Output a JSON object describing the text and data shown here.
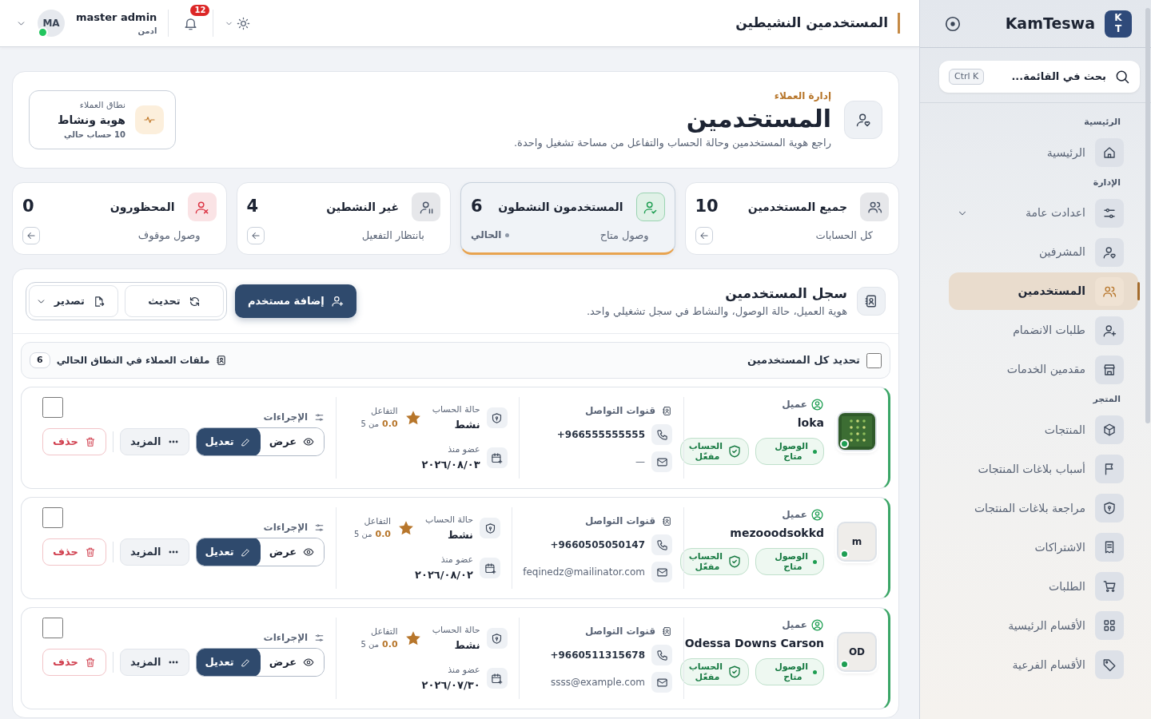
{
  "sidebar": {
    "brand": "KamTeswa",
    "logo": "K T",
    "search": {
      "placeholder": "بحث في القائمة...",
      "shortcut": "Ctrl K"
    },
    "sections": [
      {
        "title": "الرئيسية",
        "items": [
          {
            "label": "الرئيسية",
            "kind": "link",
            "selected": false
          }
        ]
      },
      {
        "title": "الإدارة",
        "items": [
          {
            "label": "اعدادت عامة",
            "kind": "group",
            "selected": false
          },
          {
            "label": "المشرفين",
            "kind": "link",
            "selected": false
          },
          {
            "label": "المستخدمين",
            "kind": "link",
            "selected": true
          },
          {
            "label": "طلبات الانضمام",
            "kind": "link",
            "selected": false
          },
          {
            "label": "مقدمين الخدمات",
            "kind": "link",
            "selected": false
          }
        ]
      },
      {
        "title": "المتجر",
        "items": [
          {
            "label": "المنتجات",
            "kind": "link",
            "selected": false
          },
          {
            "label": "أسباب بلاغات المنتجات",
            "kind": "link",
            "selected": false
          },
          {
            "label": "مراجعة بلاغات المنتجات",
            "kind": "link",
            "selected": false
          },
          {
            "label": "الاشتراكات",
            "kind": "link",
            "selected": false
          },
          {
            "label": "الطلبات",
            "kind": "link",
            "selected": false
          },
          {
            "label": "الأقسام الرئيسية",
            "kind": "link",
            "selected": false
          },
          {
            "label": "الأقسام الفرعية",
            "kind": "link",
            "selected": false
          }
        ]
      }
    ]
  },
  "topbar": {
    "title": "المستخدمين النشيطين",
    "notifications": "12",
    "user": {
      "name": "master admin",
      "role": "ادمن",
      "initials": "MA",
      "online": true
    }
  },
  "header": {
    "eyebrow": "إدارة العملاء",
    "title": "المستخدمين",
    "subtitle": "راجع هوية المستخدمين وحالة الحساب والتفاعل من مساحة تشغيل واحدة.",
    "scope": {
      "label": "نطاق العملاء",
      "value": "هوية ونشاط",
      "count": "10 حساب حالي"
    }
  },
  "stats": [
    {
      "title": "جميع المستخدمين",
      "value": "10",
      "note": "كل الحسابات",
      "color": "#4a5568",
      "selected": false
    },
    {
      "title": "المستخدمون النشطون",
      "value": "6",
      "note": "وصول متاح",
      "current": "الحالي",
      "color": "#1e9e52",
      "selected": true
    },
    {
      "title": "غير النشطين",
      "value": "4",
      "note": "بانتظار التفعيل",
      "color": "#4a5568",
      "selected": false
    },
    {
      "title": "المحظورون",
      "value": "0",
      "note": "وصول موقوف",
      "color": "#dc3545",
      "selected": false
    }
  ],
  "registry": {
    "title": "سجل المستخدمين",
    "subtitle": "هوية العميل، حالة الوصول، والنشاط في سجل تشغيلي واحد.",
    "add_button": "إضافة مستخدم",
    "refresh_button": "تحديث",
    "export_button": "تصدير",
    "select_all": {
      "label": "تحديد كل المستخدمين",
      "checked": false
    },
    "files_label": "ملفات العملاء في النطاق الحالي",
    "files_count": "6"
  },
  "users": [
    {
      "online": true,
      "checked": false,
      "role": "عميل",
      "name": "loka",
      "access": "الوصول متاح",
      "account": "الحساب مفعّل",
      "contacts_title": "قنوات التواصل",
      "phone": "+966555555555",
      "email": "—",
      "status_label": "حالة الحساب",
      "status": "نشط",
      "since_label": "عضو منذ",
      "since": "٢٠٢٦/٠٨/٠٣",
      "engagement_label": "التفاعل",
      "score": "0.0",
      "score_of": "من 5",
      "actions_label": "الإجراءات",
      "view": "عرض",
      "edit": "تعديل",
      "more": "المزيد",
      "delete": "حذف"
    },
    {
      "avatar": {
        "kind": "initials",
        "text": "m"
      },
      "online": true,
      "checked": false,
      "role": "عميل",
      "name": "mezooodsokkd",
      "access": "الوصول متاح",
      "account": "الحساب مفعّل",
      "contacts_title": "قنوات التواصل",
      "phone": "+9660505050147",
      "email": "feqinedz@mailinator.com",
      "status_label": "حالة الحساب",
      "status": "نشط",
      "since_label": "عضو منذ",
      "since": "٢٠٢٦/٠٨/٠٢",
      "engagement_label": "التفاعل",
      "score": "0.0",
      "score_of": "من 5",
      "actions_label": "الإجراءات",
      "view": "عرض",
      "edit": "تعديل",
      "more": "المزيد",
      "delete": "حذف"
    },
    {
      "avatar": {
        "kind": "initials",
        "text": "OD"
      },
      "online": true,
      "checked": false,
      "role": "عميل",
      "name": "Odessa Downs Carson",
      "access": "الوصول متاح",
      "account": "الحساب مفعّل",
      "contacts_title": "قنوات التواصل",
      "phone": "+9660511315678",
      "email": "ssss@example.com",
      "status_label": "حالة الحساب",
      "status": "نشط",
      "since_label": "عضو منذ",
      "since": "٢٠٢٦/٠٧/٣٠",
      "engagement_label": "التفاعل",
      "score": "0.0",
      "score_of": "من 5",
      "actions_label": "الإجراءات",
      "view": "عرض",
      "edit": "تعديل",
      "more": "المزيد",
      "delete": "حذف"
    }
  ]
}
